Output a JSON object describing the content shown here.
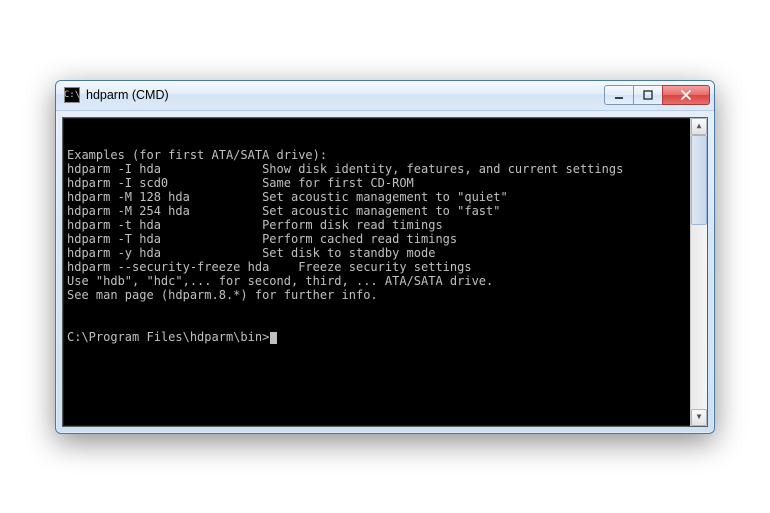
{
  "window": {
    "title": "hdparm (CMD)",
    "icon_glyph": "C:\\"
  },
  "console": {
    "lines": [
      "Examples (for first ATA/SATA drive):",
      "hdparm -I hda              Show disk identity, features, and current settings",
      "hdparm -I scd0             Same for first CD-ROM",
      "hdparm -M 128 hda          Set acoustic management to \"quiet\"",
      "hdparm -M 254 hda          Set acoustic management to \"fast\"",
      "hdparm -t hda              Perform disk read timings",
      "hdparm -T hda              Perform cached read timings",
      "hdparm -y hda              Set disk to standby mode",
      "hdparm --security-freeze hda    Freeze security settings",
      "Use \"hdb\", \"hdc\",... for second, third, ... ATA/SATA drive.",
      "See man page (hdparm.8.*) for further info.",
      ""
    ],
    "prompt": "C:\\Program Files\\hdparm\\bin>"
  }
}
